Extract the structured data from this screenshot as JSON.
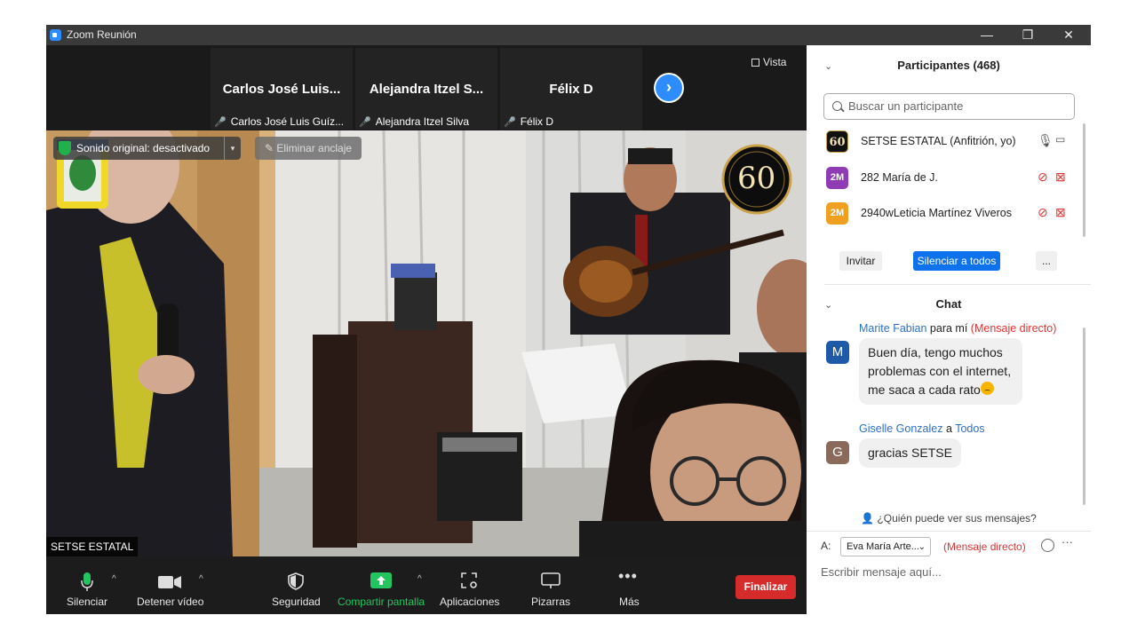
{
  "window": {
    "title": "Zoom Reunión",
    "controls": [
      "—",
      "❐",
      "✕"
    ]
  },
  "strip": {
    "tiles": [
      {
        "display": "Carlos José Luis...",
        "label": "Carlos José Luis Guíz..."
      },
      {
        "display": "Alejandra Itzel S...",
        "label": "Alejandra Itzel Silva"
      },
      {
        "display": "Félix D",
        "label": "Félix D"
      }
    ],
    "view_label": "Vista"
  },
  "video": {
    "sound_label": "Sonido original: desactivado",
    "unpin_label": "Eliminar anclaje",
    "name_tag": "SETSE ESTATAL",
    "logo_text": "60"
  },
  "toolbar": {
    "mute": "Silenciar",
    "video": "Detener vídeo",
    "security": "Seguridad",
    "share": "Compartir pantalla",
    "apps": "Aplicaciones",
    "whiteboards": "Pizarras",
    "more": "Más",
    "end": "Finalizar",
    "colors": {
      "end": "#d52b2b",
      "share": "#22c55e",
      "mic": "#22c55e"
    }
  },
  "participants": {
    "header": "Participantes (468)",
    "search_placeholder": "Buscar un participante",
    "list": [
      {
        "avatar": "60",
        "avatar_color": "#111111",
        "name": "SETSE ESTATAL (Anfitrión, yo)",
        "muted": false
      },
      {
        "avatar": "2M",
        "avatar_color": "#8e3bb5",
        "name": "282 María de J.",
        "muted": true
      },
      {
        "avatar": "2M",
        "avatar_color": "#f0a020",
        "name": "2940wLeticia Martínez Viveros",
        "muted": true
      }
    ],
    "invite": "Invitar",
    "mute_all": "Silenciar a todos",
    "more": "..."
  },
  "chat": {
    "header": "Chat",
    "messages": [
      {
        "sender": "Marite Fabian",
        "connector": "para mí",
        "target": "(Mensaje directo)",
        "avatar": "M",
        "avatar_color": "#1e5aa8",
        "text": "Buen día, tengo muchos problemas con el internet, me saca a cada rato"
      },
      {
        "sender": "Giselle Gonzalez",
        "connector": "a",
        "target": "Todos",
        "avatar": "G",
        "avatar_color": "#8a6a5a",
        "text": "gracias SETSE"
      }
    ],
    "who_can_see": "¿Quién puede ver sus mensajes?",
    "to_label": "A:",
    "to_value": "Eva María Arte...",
    "dm_label": "(Mensaje directo)",
    "input_placeholder": "Escribir mensaje aquí..."
  }
}
